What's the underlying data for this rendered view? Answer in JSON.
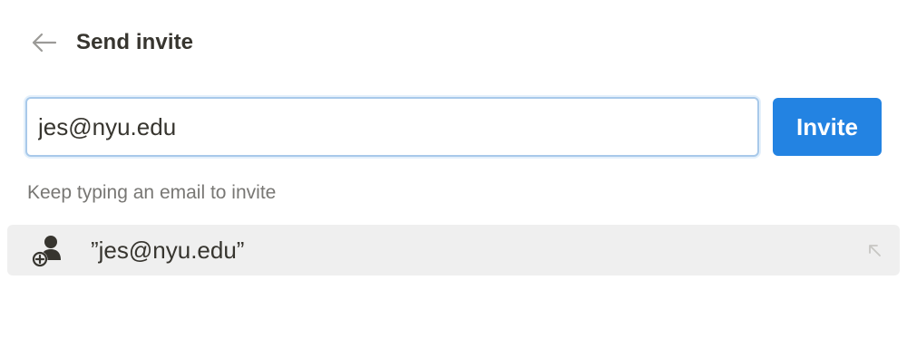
{
  "header": {
    "title": "Send invite",
    "back_icon": "arrow-left-icon"
  },
  "invite": {
    "email_value": "jes@nyu.edu",
    "button_label": "Invite",
    "accent_color": "#2383e2"
  },
  "hint": {
    "text": "Keep typing an email to invite"
  },
  "suggestion": {
    "label": "”jes@nyu.edu”",
    "icon": "add-person-icon",
    "enter_icon": "arrow-up-left-icon"
  }
}
